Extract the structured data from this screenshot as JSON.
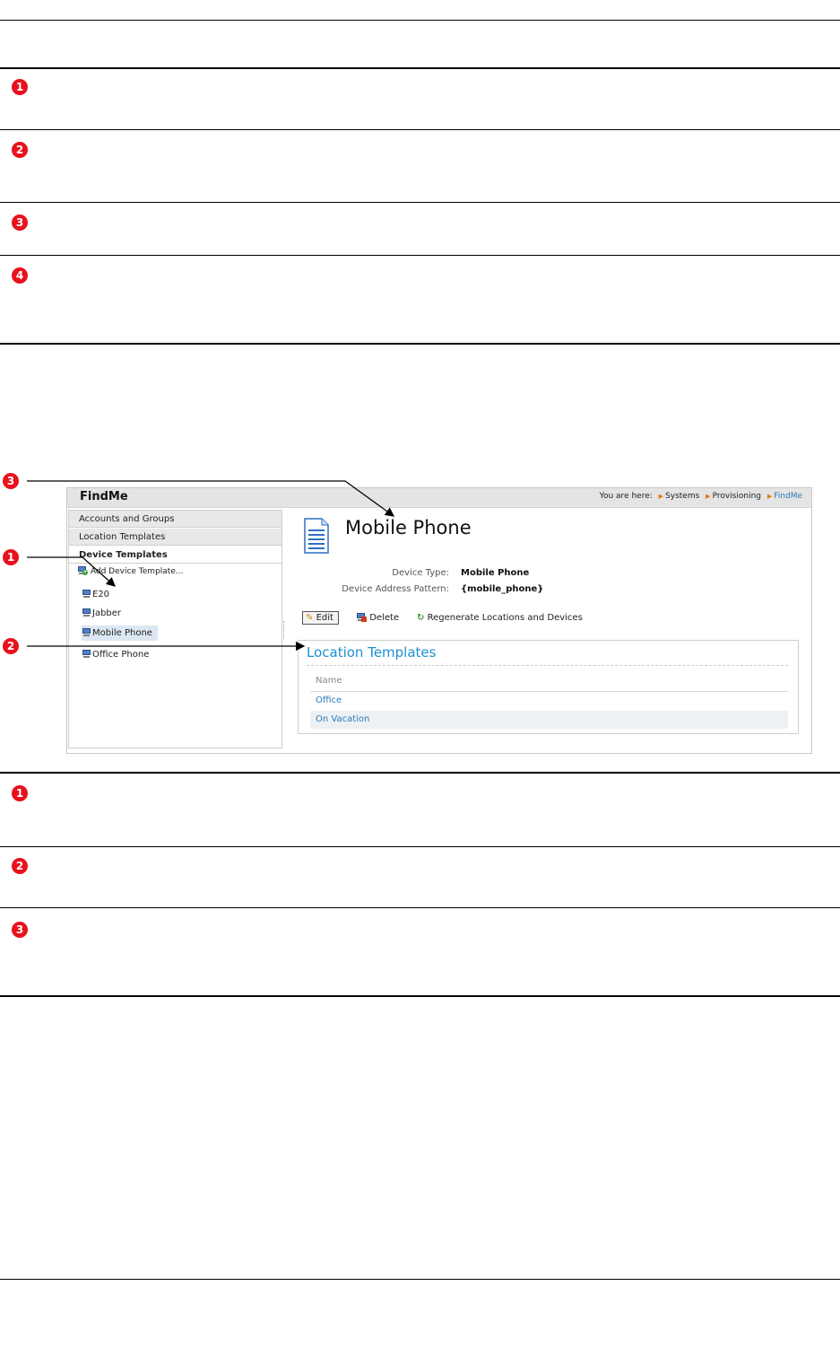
{
  "callout_numbers": [
    "1",
    "2",
    "3",
    "4"
  ],
  "screenshot": {
    "app_title": "FindMe",
    "breadcrumb": {
      "prefix": "You are here:",
      "items": [
        "Systems",
        "Provisioning",
        "FindMe"
      ]
    },
    "sidebar": {
      "sections": [
        "Accounts and Groups",
        "Location Templates",
        "Device Templates"
      ],
      "add_label": "Add Device Template...",
      "devices": [
        "E20",
        "Jabber",
        "Mobile Phone",
        "Office Phone"
      ],
      "selected_device": "Mobile Phone"
    },
    "detail": {
      "title": "Mobile Phone",
      "device_type_label": "Device Type:",
      "device_type_value": "Mobile Phone",
      "address_pattern_label": "Device Address Pattern:",
      "address_pattern_value": "{mobile_phone}"
    },
    "toolbar": {
      "edit_label": "Edit",
      "delete_label": "Delete",
      "regenerate_label": "Regenerate Locations and Devices"
    },
    "location_templates": {
      "heading": "Location Templates",
      "column": "Name",
      "rows": [
        "Office",
        "On Vacation"
      ]
    },
    "annotations": [
      "1",
      "2",
      "3"
    ],
    "colors": {
      "accent_link": "#2a7bbd",
      "heading_blue": "#1d8fd0",
      "callout_red": "#e8111c",
      "breadcrumb_arrow": "#e87a00"
    }
  }
}
